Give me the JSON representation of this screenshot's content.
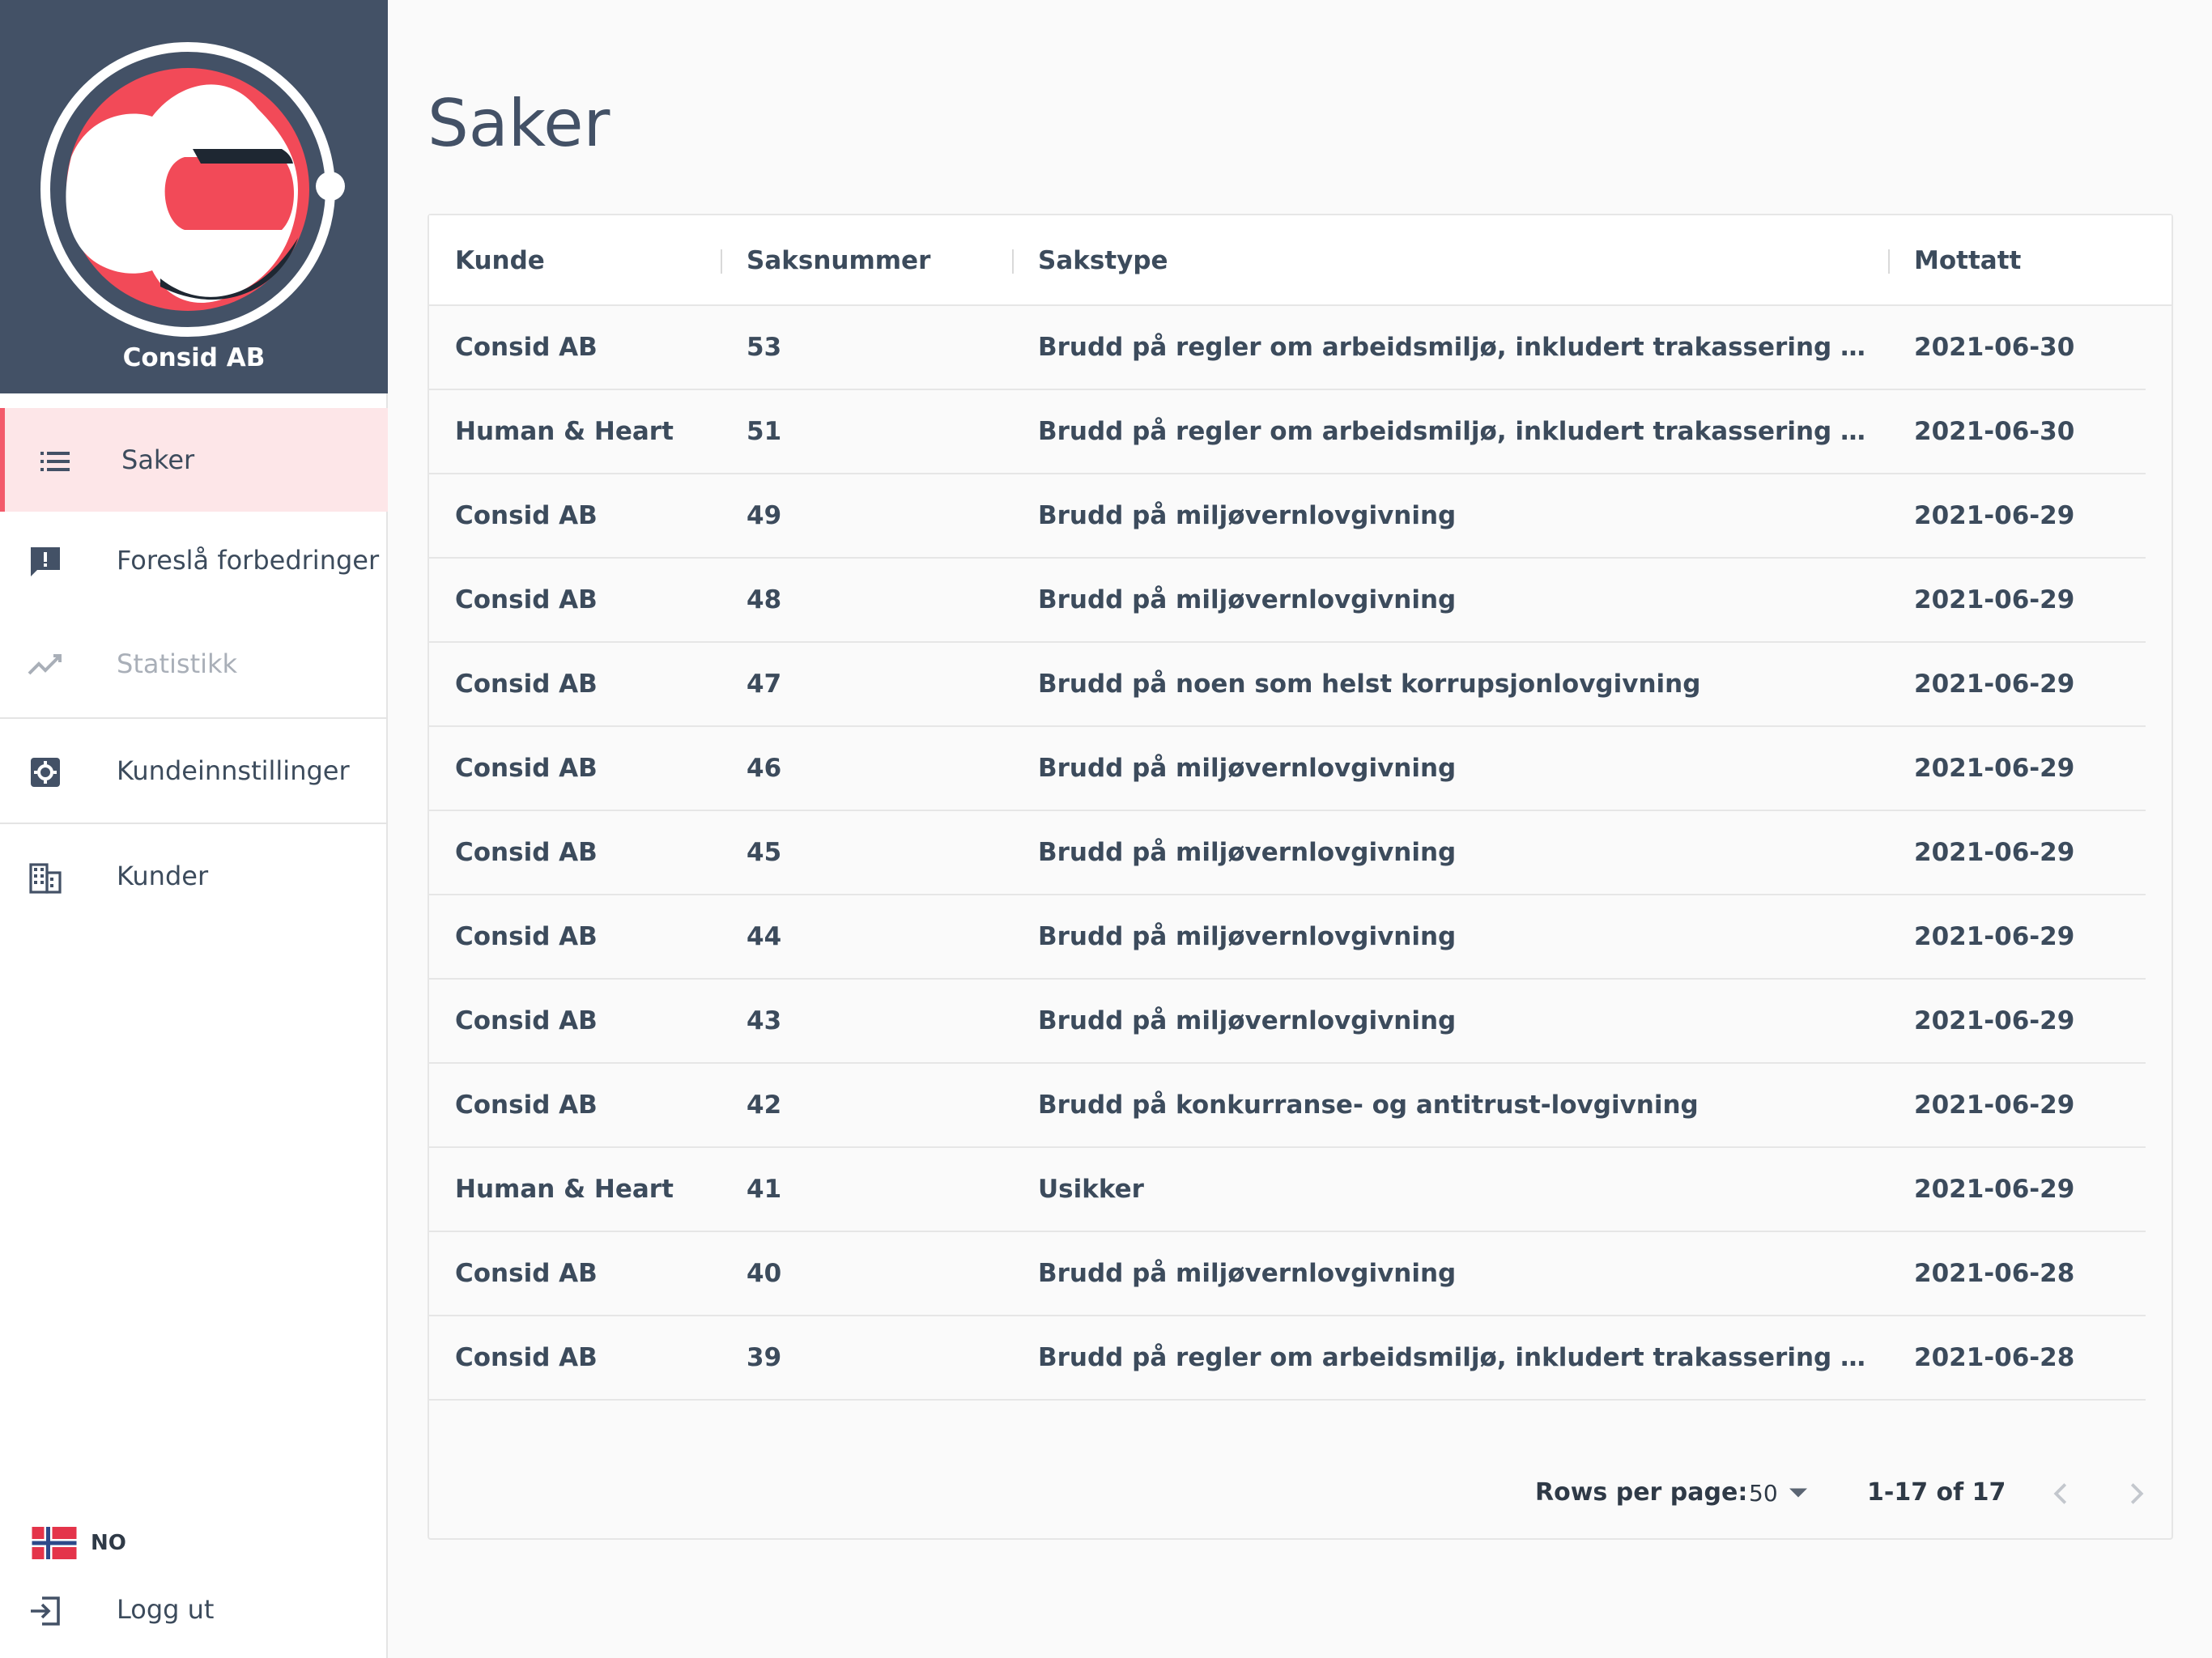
{
  "sidebar": {
    "brand_name": "Consid AB",
    "nav": [
      {
        "label": "Saker",
        "icon": "list-icon",
        "active": true
      },
      {
        "label": "Foreslå forbedringer",
        "icon": "feedback-icon"
      },
      {
        "label": "Statistikk",
        "icon": "trending-icon",
        "disabled": true
      },
      {
        "label": "Kundeinnstillinger",
        "icon": "gear-icon"
      },
      {
        "label": "Kunder",
        "icon": "building-icon"
      }
    ],
    "language": "NO",
    "logout_label": "Logg ut"
  },
  "page": {
    "title": "Saker"
  },
  "table": {
    "headers": {
      "kunde": "Kunde",
      "saksnummer": "Saksnummer",
      "sakstype": "Sakstype",
      "mottatt": "Mottatt"
    },
    "rows": [
      {
        "kunde": "Consid AB",
        "nr": "53",
        "type": "Brudd på regler om arbeidsmiljø, inkludert trakassering og krenk...",
        "date": "2021-06-30"
      },
      {
        "kunde": "Human & Heart",
        "nr": "51",
        "type": "Brudd på regler om arbeidsmiljø, inkludert trakassering og krenk...",
        "date": "2021-06-30"
      },
      {
        "kunde": "Consid AB",
        "nr": "49",
        "type": "Brudd på miljøvernlovgivning",
        "date": "2021-06-29"
      },
      {
        "kunde": "Consid AB",
        "nr": "48",
        "type": "Brudd på miljøvernlovgivning",
        "date": "2021-06-29"
      },
      {
        "kunde": "Consid AB",
        "nr": "47",
        "type": "Brudd på noen som helst korrupsjonlovgivning",
        "date": "2021-06-29"
      },
      {
        "kunde": "Consid AB",
        "nr": "46",
        "type": "Brudd på miljøvernlovgivning",
        "date": "2021-06-29"
      },
      {
        "kunde": "Consid AB",
        "nr": "45",
        "type": "Brudd på miljøvernlovgivning",
        "date": "2021-06-29"
      },
      {
        "kunde": "Consid AB",
        "nr": "44",
        "type": "Brudd på miljøvernlovgivning",
        "date": "2021-06-29"
      },
      {
        "kunde": "Consid AB",
        "nr": "43",
        "type": "Brudd på miljøvernlovgivning",
        "date": "2021-06-29"
      },
      {
        "kunde": "Consid AB",
        "nr": "42",
        "type": "Brudd på konkurranse- og antitrust-lovgivning",
        "date": "2021-06-29"
      },
      {
        "kunde": "Human & Heart",
        "nr": "41",
        "type": "Usikker",
        "date": "2021-06-29"
      },
      {
        "kunde": "Consid AB",
        "nr": "40",
        "type": "Brudd på miljøvernlovgivning",
        "date": "2021-06-28"
      },
      {
        "kunde": "Consid AB",
        "nr": "39",
        "type": "Brudd på regler om arbeidsmiljø, inkludert trakassering og krenk...",
        "date": "2021-06-28"
      }
    ]
  },
  "pagination": {
    "rows_per_page_label": "Rows per page:",
    "rows_per_page": "50",
    "range": "1-17 of 17"
  },
  "colors": {
    "brand_bg": "#435166",
    "accent": "#f35a6a",
    "active_bg": "#fde6e8",
    "text": "#3c4b5c"
  }
}
